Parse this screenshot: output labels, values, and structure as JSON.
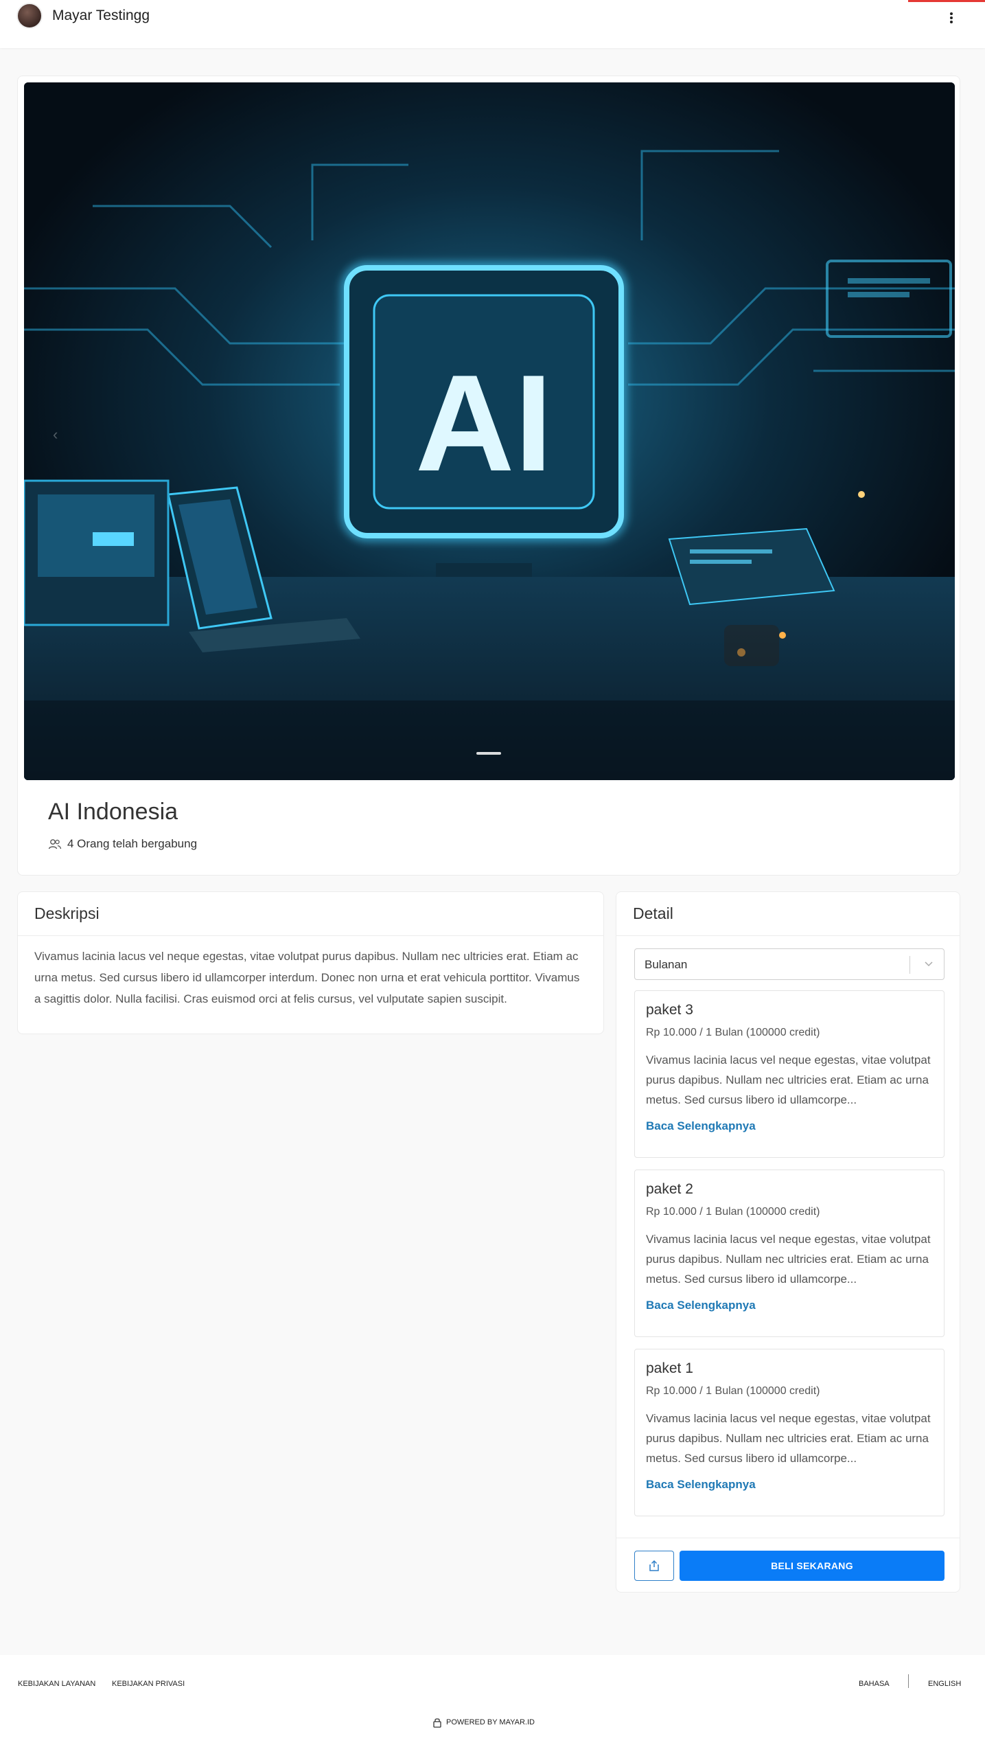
{
  "header": {
    "shop_name": "Mayar Testingg"
  },
  "hero": {
    "image_text": "AI",
    "title": "AI Indonesia",
    "joined_text": "4 Orang telah bergabung",
    "carousel_prev_glyph": "‹"
  },
  "description": {
    "heading": "Deskripsi",
    "body": "Vivamus lacinia lacus vel neque egestas, vitae volutpat purus dapibus. Nullam nec ultricies erat. Etiam ac urna metus. Sed cursus libero id ullamcorper interdum. Donec non urna et erat vehicula porttitor. Vivamus a sagittis dolor. Nulla facilisi. Cras euismod orci at felis cursus, vel vulputate sapien suscipit."
  },
  "detail": {
    "heading": "Detail",
    "period_select": {
      "value": "Bulanan"
    },
    "packages": [
      {
        "name": "paket 3",
        "price": "Rp 10.000 / 1 Bulan (100000 credit)",
        "description": "Vivamus lacinia lacus vel neque egestas, vitae volutpat purus dapibus. Nullam nec ultricies erat. Etiam ac urna metus. Sed cursus libero id ullamcorpe...",
        "link": "Baca Selengkapnya"
      },
      {
        "name": "paket 2",
        "price": "Rp 10.000 / 1 Bulan (100000 credit)",
        "description": "Vivamus lacinia lacus vel neque egestas, vitae volutpat purus dapibus. Nullam nec ultricies erat. Etiam ac urna metus. Sed cursus libero id ullamcorpe...",
        "link": "Baca Selengkapnya"
      },
      {
        "name": "paket 1",
        "price": "Rp 10.000 / 1 Bulan (100000 credit)",
        "description": "Vivamus lacinia lacus vel neque egestas, vitae volutpat purus dapibus. Nullam nec ultricies erat. Etiam ac urna metus. Sed cursus libero id ullamcorpe...",
        "link": "Baca Selengkapnya"
      }
    ],
    "buy_label": "BELI SEKARANG"
  },
  "footer": {
    "terms": "KEBIJAKAN LAYANAN",
    "privacy": "KEBIJAKAN PRIVASI",
    "language_label": "BAHASA",
    "language_value": "ENGLISH",
    "powered_by": "POWERED BY MAYAR.ID"
  },
  "colors": {
    "primary_button": "#0a7cf7",
    "link": "#1f79b5",
    "accent_line": "#e53935",
    "hero_glow": "#3fc8f5"
  },
  "icons": [
    "kebab-menu-icon",
    "users-icon",
    "chevron-down-icon",
    "share-icon",
    "lock-icon",
    "chevron-left-icon"
  ]
}
